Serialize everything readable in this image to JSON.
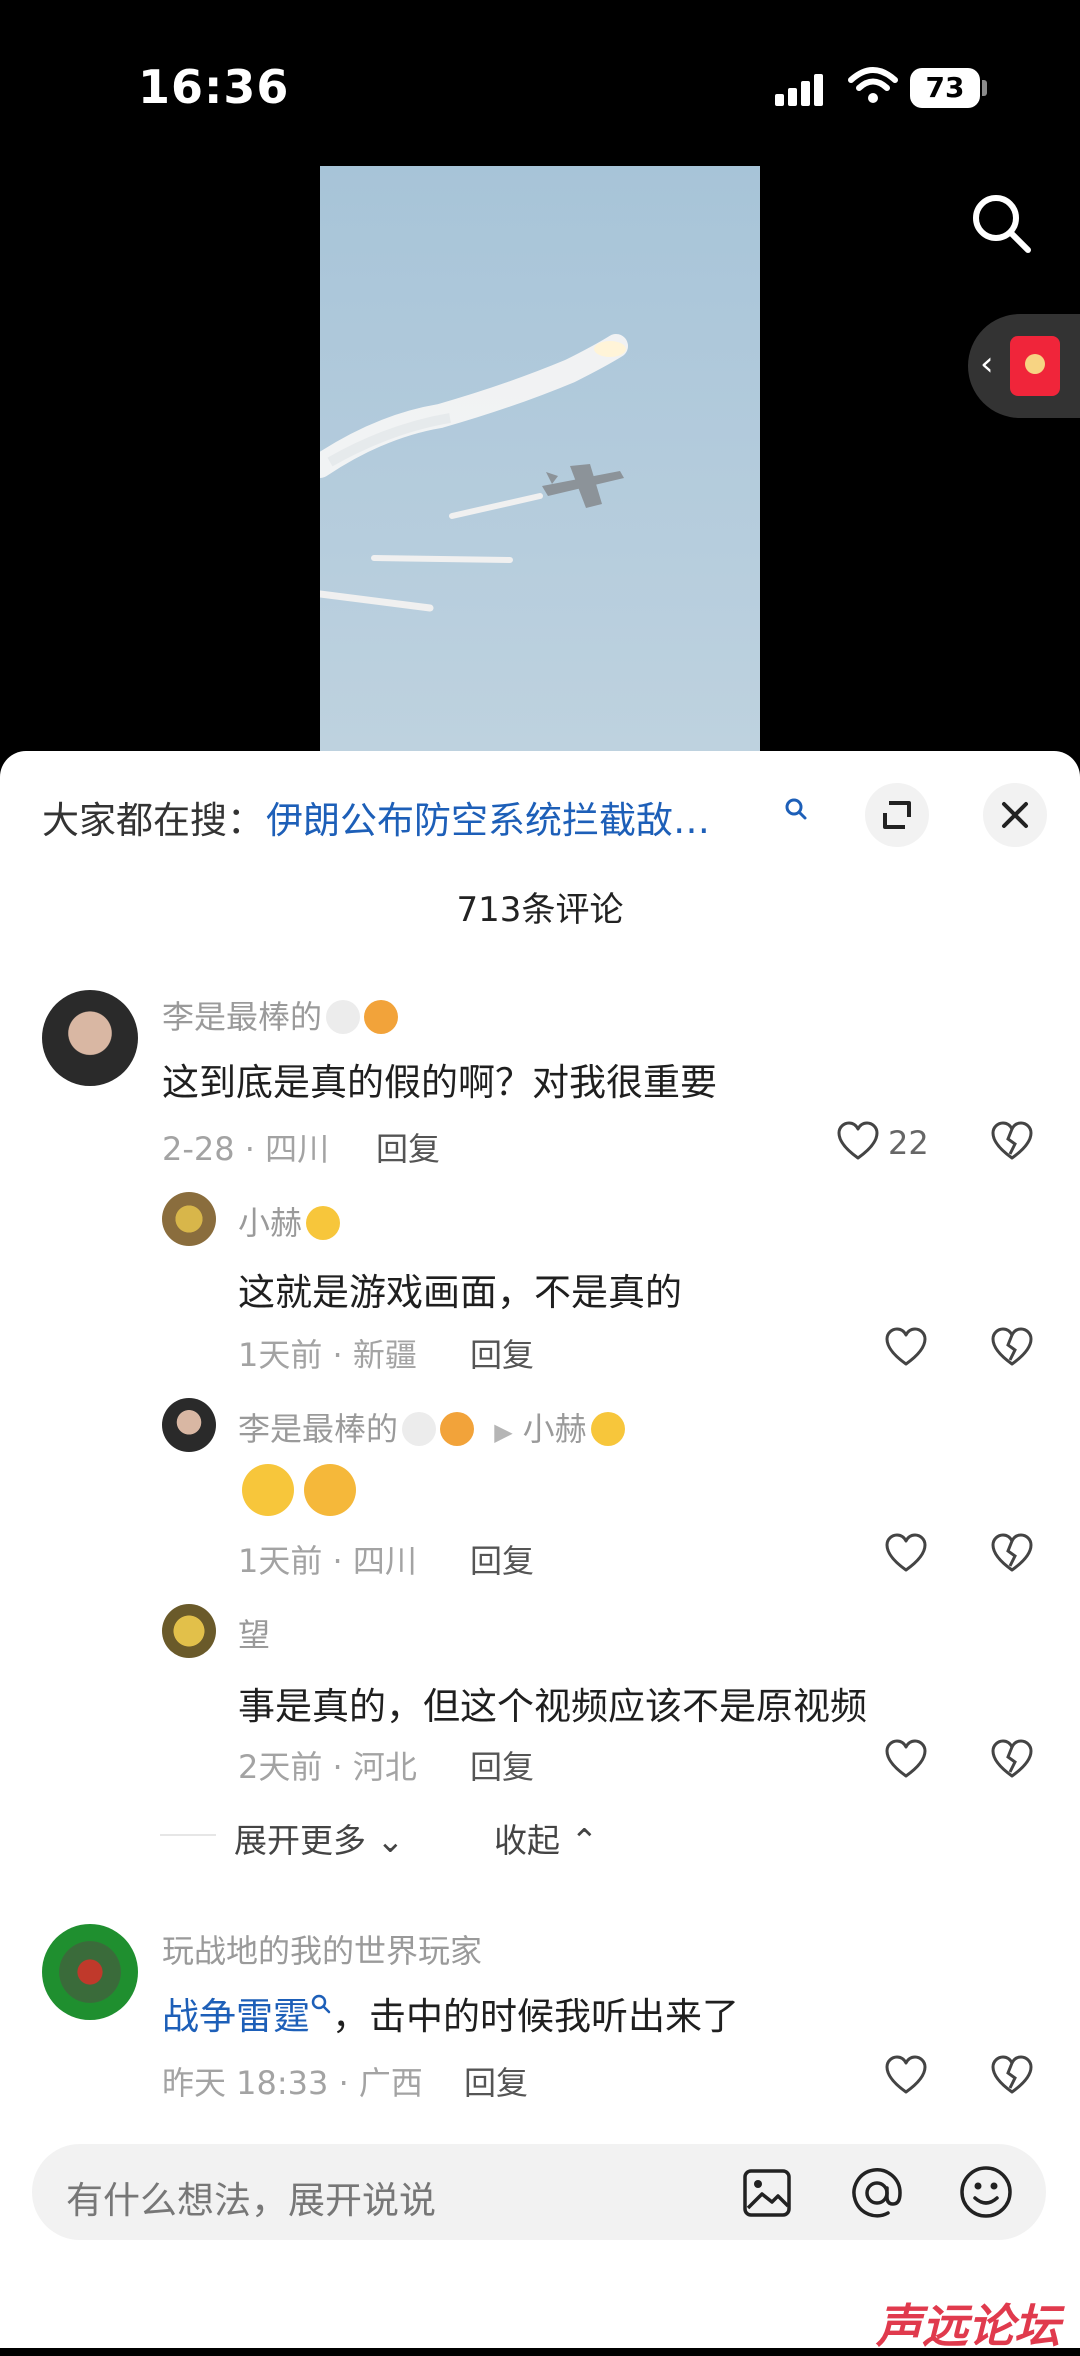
{
  "status_bar": {
    "time": "16:36",
    "battery": "73"
  },
  "hot_search": {
    "label": "大家都在搜：",
    "query": "伊朗公布防空系统拦截敌…"
  },
  "comments_count": "713条评论",
  "comments": [
    {
      "user": "李是最棒的",
      "text": "这到底是真的假的啊？对我很重要",
      "meta": "2-28 · 四川",
      "reply": "回复",
      "likes": "22"
    },
    {
      "user": "小赫",
      "text": "这就是游戏画面，不是真的",
      "meta": "1天前 · 新疆",
      "reply": "回复"
    },
    {
      "user": "李是最棒的",
      "reply_to": "小赫",
      "meta": "1天前 · 四川",
      "reply": "回复"
    },
    {
      "user": "望",
      "text": "事是真的，但这个视频应该不是原视频",
      "meta": "2天前 · 河北",
      "reply": "回复"
    },
    {
      "user": "玩战地的我的世界玩家",
      "mention": "战争雷霆",
      "text": "，击中的时候我听出来了",
      "meta": "昨天 18:33 · 广西",
      "reply": "回复"
    }
  ],
  "expand_more": "展开更多",
  "collapse": "收起",
  "input": {
    "placeholder": "有什么想法，展开说说"
  },
  "watermark": "声远论坛",
  "colors": {
    "accent_blue": "#1d5fb8",
    "red_packet": "#f0253a"
  },
  "icons": [
    "search-icon",
    "red-packet-icon",
    "expand-icon",
    "close-icon",
    "heart-icon",
    "broken-heart-icon",
    "image-icon",
    "at-icon",
    "emoji-icon"
  ]
}
